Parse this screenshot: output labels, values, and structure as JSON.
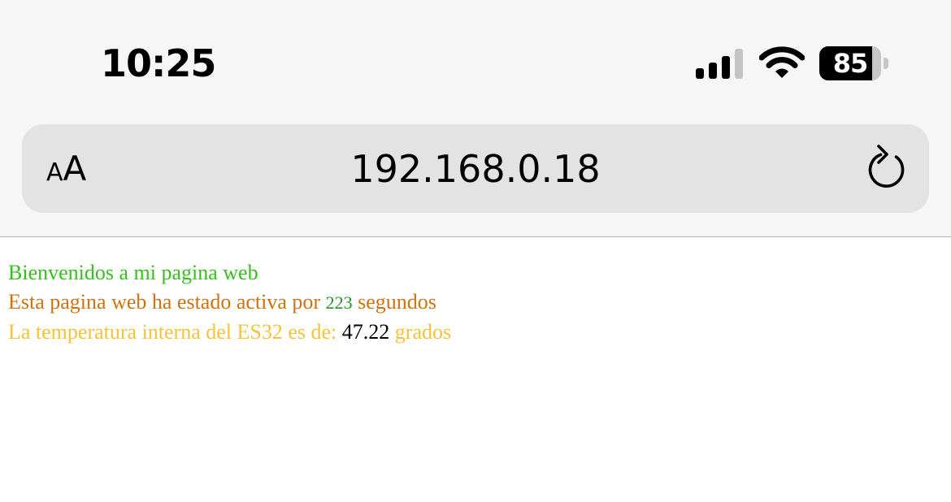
{
  "status_bar": {
    "time": "10:25",
    "battery_level": "85",
    "battery_fraction": 0.85,
    "icons": [
      "cellular-signal-icon",
      "wifi-icon",
      "battery-icon"
    ]
  },
  "browser": {
    "text_size_small": "A",
    "text_size_large": "A",
    "url": "192.168.0.18",
    "icons": [
      "reload-icon"
    ]
  },
  "page": {
    "welcome": "Bienvenidos a mi pagina web",
    "uptime_prefix": "Esta pagina web ha estado activa por",
    "uptime_value": "223",
    "uptime_suffix": "segundos",
    "temp_prefix": "La temperatura interna del ES32 es de:",
    "temp_value": "47.22",
    "temp_suffix": "grados"
  },
  "colors": {
    "welcome": "#36bf1f",
    "uptime_text": "#d0720f",
    "uptime_value": "#23942a",
    "temp_text": "#f6c338",
    "temp_value": "#000000"
  }
}
